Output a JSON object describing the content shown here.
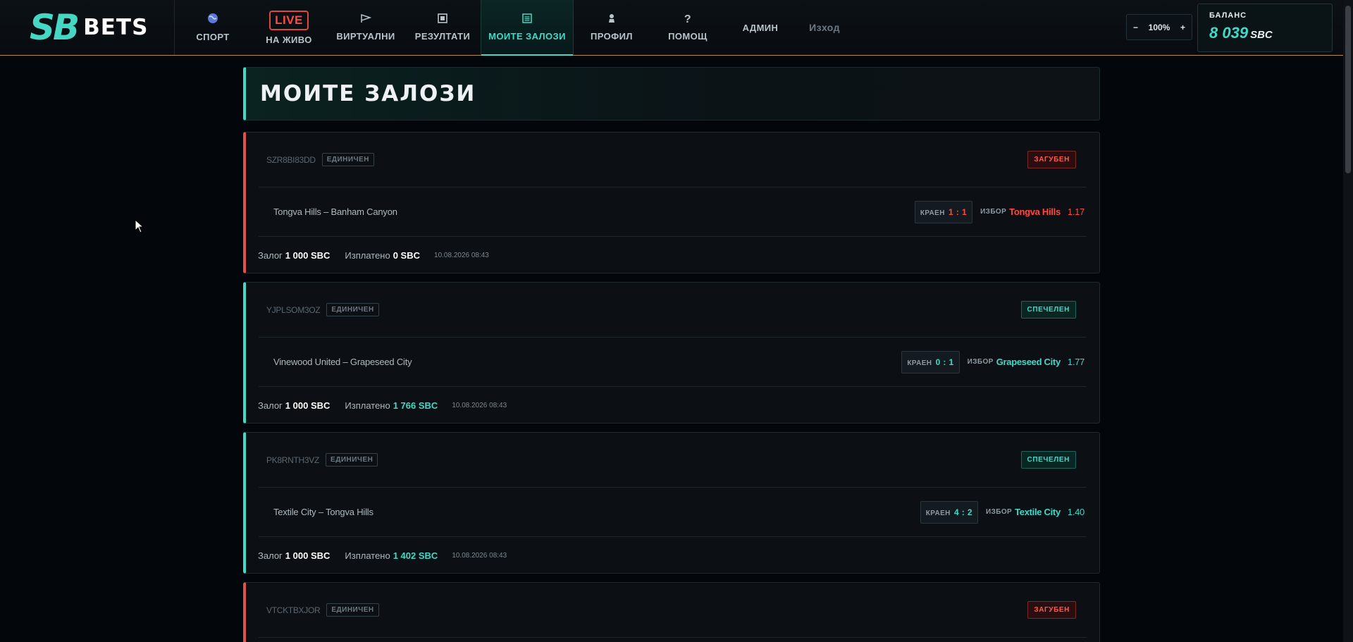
{
  "brand": {
    "logo_sb": "SB",
    "logo_bets": "BETS"
  },
  "nav": {
    "sport": "СПОРТ",
    "live_badge": "LIVE",
    "live": "НА ЖИВО",
    "virtual": "ВИРТУАЛНИ",
    "results": "РЕЗУЛТАТИ",
    "my_bets": "МОИТЕ ЗАЛОЗИ",
    "profile": "ПРОФИЛ",
    "help": "ПОМОЩ",
    "admin": "АДМИН",
    "logout": "Изход"
  },
  "zoom": {
    "minus": "−",
    "value": "100%",
    "plus": "+"
  },
  "balance": {
    "label": "БАЛАНС",
    "amount": "8 039",
    "currency": "SBC"
  },
  "page": {
    "title": "МОИТЕ ЗАЛОЗИ"
  },
  "labels": {
    "final": "КРАЕН",
    "pick": "ИЗБОР",
    "stake": "Залог",
    "paid": "Изплатено"
  },
  "bets": [
    {
      "id": "SZR8BI83DD",
      "type": "ЕДИНИЧЕН",
      "status": "ЗАГУБЕН",
      "match": "Tongva Hills – Banham Canyon",
      "score": "1 : 1",
      "pick": "Tongva Hills",
      "odds": "1.17",
      "stake": "1 000 SBC",
      "paid": "0 SBC",
      "date": "10.08.2026 08:43"
    },
    {
      "id": "YJPLSOM3OZ",
      "type": "ЕДИНИЧЕН",
      "status": "СПЕЧЕЛЕН",
      "match": "Vinewood United – Grapeseed City",
      "score": "0 : 1",
      "pick": "Grapeseed City",
      "odds": "1.77",
      "stake": "1 000 SBC",
      "paid": "1 766 SBC",
      "date": "10.08.2026 08:43"
    },
    {
      "id": "PK8RNTH3VZ",
      "type": "ЕДИНИЧЕН",
      "status": "СПЕЧЕЛЕН",
      "match": "Textile City – Tongva Hills",
      "score": "4 : 2",
      "pick": "Textile City",
      "odds": "1.40",
      "stake": "1 000 SBC",
      "paid": "1 402 SBC",
      "date": "10.08.2026 08:43"
    },
    {
      "id": "VTCKTBXJOR",
      "type": "ЕДИНИЧЕН",
      "status": "ЗАГУБЕН"
    }
  ],
  "colors": {
    "accent": "#44d8c6",
    "lost": "#ff4a42",
    "background": "#03070b"
  },
  "icons": {
    "sport": "globe-icon",
    "virtual": "flag-icon",
    "results": "scoreboard-icon",
    "my_bets": "list-icon",
    "profile": "person-icon",
    "help": "question-icon"
  }
}
